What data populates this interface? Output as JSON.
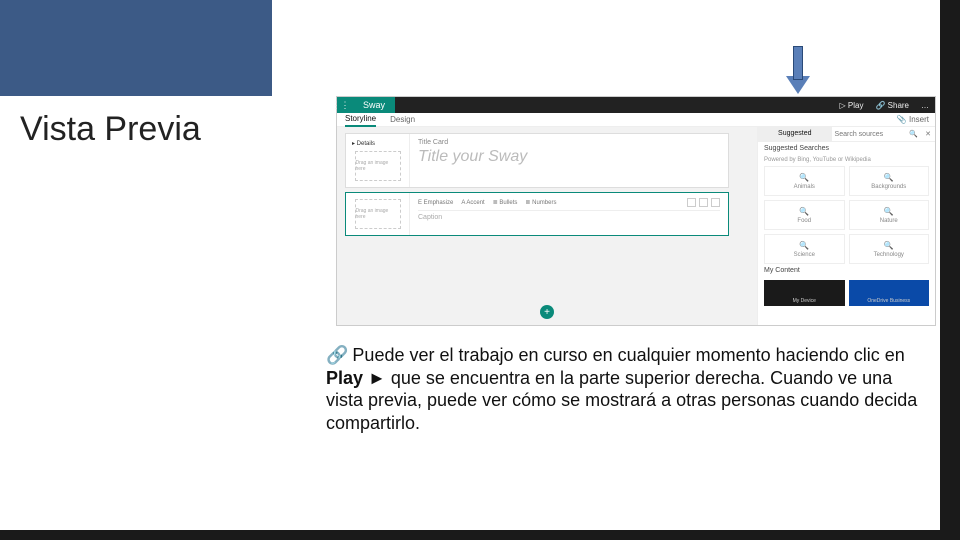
{
  "slide": {
    "title": "Vista Previa",
    "body_lead": "Puede ver el trabajo en curso en cualquier momento haciendo clic en ",
    "body_bold": "Play ►",
    "body_tail": " que se encuentra en la parte superior derecha. Cuando ve una vista previa, puede ver cómo se mostrará a otras personas cuando decida compartirlo."
  },
  "app": {
    "brand": "Sway",
    "topbar": {
      "play": "▷  Play",
      "share": "🔗  Share",
      "dots": "…"
    },
    "tabs": {
      "storyline": "Storyline",
      "design": "Design",
      "insert": "📎 Insert"
    },
    "titlecard": {
      "details": "▸ Details",
      "drop": "Drag an image here",
      "label": "Title Card",
      "placeholder": "Title your Sway"
    },
    "textcard": {
      "drop": "Drag an image here",
      "tools": {
        "emphasize": "E Emphasize",
        "accent": "A Accent",
        "bullets": "≣ Bullets",
        "numbers": "≣ Numbers"
      },
      "caption": "Caption"
    },
    "plus": "+",
    "panel": {
      "tabs": {
        "suggested": "Suggested",
        "search_ph": "Search sources",
        "search_icon": "🔍",
        "close": "✕"
      },
      "hint": "Powered by Bing, YouTube or Wikipedia",
      "section1": "Suggested Searches",
      "items": [
        {
          "icon": "🔍",
          "label": "Animals"
        },
        {
          "icon": "🔍",
          "label": "Backgrounds"
        },
        {
          "icon": "🔍",
          "label": "Food"
        },
        {
          "icon": "🔍",
          "label": "Nature"
        },
        {
          "icon": "🔍",
          "label": "Science"
        },
        {
          "icon": "🔍",
          "label": "Technology"
        }
      ],
      "section2": "My Content",
      "mc1": "My Device",
      "mc2": "OneDrive Business"
    }
  }
}
